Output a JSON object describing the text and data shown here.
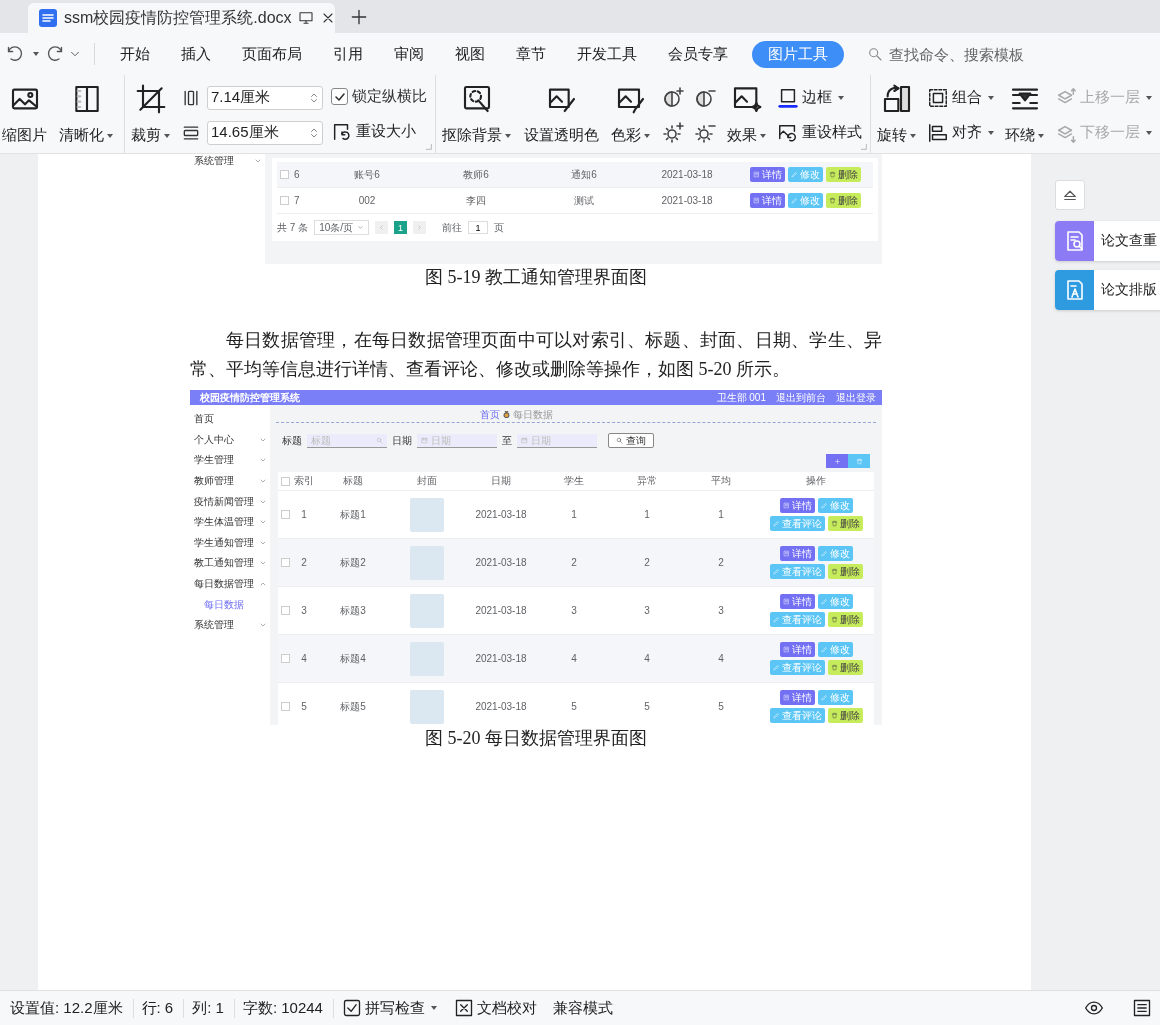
{
  "tab": {
    "title": "ssm校园疫情防控管理系统.docx"
  },
  "menu": [
    {
      "label": "开始",
      "selected": false
    },
    {
      "label": "插入",
      "selected": false
    },
    {
      "label": "页面布局",
      "selected": false
    },
    {
      "label": "引用",
      "selected": false
    },
    {
      "label": "审阅",
      "selected": false
    },
    {
      "label": "视图",
      "selected": false
    },
    {
      "label": "章节",
      "selected": false
    },
    {
      "label": "开发工具",
      "selected": false
    },
    {
      "label": "会员专享",
      "selected": false
    },
    {
      "label": "图片工具",
      "selected": true
    }
  ],
  "search": {
    "placeholder": "查找命令、搜索模板"
  },
  "ribbon": [
    {
      "label": "缩图片",
      "dropdown": false,
      "disabled": false
    },
    {
      "label": "清晰化",
      "dropdown": true,
      "disabled": false
    },
    {
      "label": "裁剪",
      "dropdown": true,
      "disabled": false
    },
    {
      "value": "7.14厘米"
    },
    {
      "value": "14.65厘米"
    },
    {
      "label": "锁定纵横比",
      "checked": true
    },
    {
      "label": "重设大小",
      "dropdown": false,
      "disabled": false
    },
    {
      "label": "抠除背景",
      "dropdown": true,
      "disabled": false
    },
    {
      "label": "设置透明色",
      "dropdown": false,
      "disabled": false
    },
    {
      "label": "色彩",
      "dropdown": true,
      "disabled": false
    },
    {
      "label": "效果",
      "dropdown": true,
      "disabled": false
    },
    {
      "label": "边框",
      "dropdown": true,
      "disabled": false
    },
    {
      "label": "重设样式",
      "dropdown": false,
      "disabled": false
    },
    {
      "label": "旋转",
      "dropdown": true,
      "disabled": false
    },
    {
      "label": "组合",
      "dropdown": true,
      "disabled": false
    },
    {
      "label": "对齐",
      "dropdown": true,
      "disabled": false
    },
    {
      "label": "环绕",
      "dropdown": true,
      "disabled": false
    },
    {
      "label": "上移一层",
      "dropdown": true,
      "disabled": true
    },
    {
      "label": "下移一层",
      "dropdown": true,
      "disabled": true
    }
  ],
  "page": {
    "figure1": {
      "screenshot": {
        "sidebar": [
          {
            "label": "系统管理",
            "expanded": false
          }
        ],
        "rows": [
          {
            "checked": false,
            "cells": [
              "6",
              "账号6",
              "教师6",
              "通知6",
              "2021-03-18"
            ],
            "actions": [
              {
                "label": "详情",
                "kind": "detail"
              },
              {
                "label": "修改",
                "kind": "edit"
              },
              {
                "label": "删除",
                "kind": "delete"
              }
            ]
          },
          {
            "checked": false,
            "cells": [
              "7",
              "002",
              "李四",
              "测试",
              "2021-03-18"
            ],
            "actions": [
              {
                "label": "详情",
                "kind": "detail"
              },
              {
                "label": "修改",
                "kind": "edit"
              },
              {
                "label": "删除",
                "kind": "delete"
              }
            ]
          }
        ],
        "pagination": {
          "total": "共 7 条",
          "page_size": "10条/页",
          "pages": [
            {
              "label": "1",
              "selected": true
            }
          ],
          "goto_label": "前往",
          "goto_value": "1",
          "goto_suffix": "页"
        }
      },
      "caption": "图 5-19 教工通知管理界面图"
    },
    "paragraph": "每日数据管理，在每日数据管理页面中可以对索引、标题、封面、日期、学生、异常、平均等信息进行详情、查看评论、修改或删除等操作，如图 5-20 所示。",
    "figure2": {
      "screenshot": {
        "title": "校园疫情防控管理系统",
        "header_links": [
          "卫生部 001",
          "退出到前台",
          "退出登录"
        ],
        "sidebar": [
          {
            "label": "首页"
          },
          {
            "label": "个人中心",
            "expanded": false
          },
          {
            "label": "学生管理",
            "expanded": false
          },
          {
            "label": "教师管理",
            "expanded": false
          },
          {
            "label": "疫情新闻管理",
            "expanded": false
          },
          {
            "label": "学生体温管理",
            "expanded": false
          },
          {
            "label": "学生通知管理",
            "expanded": false
          },
          {
            "label": "教工通知管理",
            "expanded": false
          },
          {
            "label": "每日数据管理",
            "expanded": true,
            "children": [
              {
                "label": "每日数据",
                "selected": true
              }
            ]
          },
          {
            "label": "系统管理",
            "expanded": false
          }
        ],
        "breadcrumb": [
          "首页",
          "每日数据"
        ],
        "filters": [
          {
            "label": "标题",
            "placeholder": "标题",
            "kind": "text"
          },
          {
            "label": "日期",
            "placeholder": "日期",
            "kind": "date"
          },
          {
            "label": "至",
            "placeholder": "日期",
            "kind": "date"
          }
        ],
        "search_button": "查询",
        "select_all_checked": false,
        "columns": [
          "索引",
          "标题",
          "封面",
          "日期",
          "学生",
          "异常",
          "平均",
          "操作"
        ],
        "rows": [
          {
            "checked": false,
            "cells": [
              "1",
              "标题1",
              "",
              "2021-03-18",
              "1",
              "1",
              "1"
            ],
            "actions": [
              {
                "label": "详情",
                "kind": "detail"
              },
              {
                "label": "修改",
                "kind": "edit"
              },
              {
                "label": "查看评论",
                "kind": "comments"
              },
              {
                "label": "删除",
                "kind": "delete"
              }
            ]
          },
          {
            "checked": false,
            "cells": [
              "2",
              "标题2",
              "",
              "2021-03-18",
              "2",
              "2",
              "2"
            ],
            "actions": [
              {
                "label": "详情",
                "kind": "detail"
              },
              {
                "label": "修改",
                "kind": "edit"
              },
              {
                "label": "查看评论",
                "kind": "comments"
              },
              {
                "label": "删除",
                "kind": "delete"
              }
            ]
          },
          {
            "checked": false,
            "cells": [
              "3",
              "标题3",
              "",
              "2021-03-18",
              "3",
              "3",
              "3"
            ],
            "actions": [
              {
                "label": "详情",
                "kind": "detail"
              },
              {
                "label": "修改",
                "kind": "edit"
              },
              {
                "label": "查看评论",
                "kind": "comments"
              },
              {
                "label": "删除",
                "kind": "delete"
              }
            ]
          },
          {
            "checked": false,
            "cells": [
              "4",
              "标题4",
              "",
              "2021-03-18",
              "4",
              "4",
              "4"
            ],
            "actions": [
              {
                "label": "详情",
                "kind": "detail"
              },
              {
                "label": "修改",
                "kind": "edit"
              },
              {
                "label": "查看评论",
                "kind": "comments"
              },
              {
                "label": "删除",
                "kind": "delete"
              }
            ]
          },
          {
            "checked": false,
            "cells": [
              "5",
              "标题5",
              "",
              "2021-03-18",
              "5",
              "5",
              "5"
            ],
            "actions": [
              {
                "label": "详情",
                "kind": "detail"
              },
              {
                "label": "修改",
                "kind": "edit"
              },
              {
                "label": "查看评论",
                "kind": "comments"
              },
              {
                "label": "删除",
                "kind": "delete"
              }
            ]
          }
        ]
      },
      "caption": "图 5-20 每日数据管理界面图"
    }
  },
  "side_panel": [
    {
      "label": "论文查重"
    },
    {
      "label": "论文排版"
    }
  ],
  "status": [
    "设置值: 12.2厘米",
    "行: 6",
    "列: 1",
    "字数: 10244"
  ],
  "status_controls": [
    {
      "label": "拼写检查",
      "dropdown": true
    },
    {
      "label": "文档校对",
      "dropdown": false
    },
    {
      "label": "兼容模式",
      "dropdown": false
    }
  ]
}
